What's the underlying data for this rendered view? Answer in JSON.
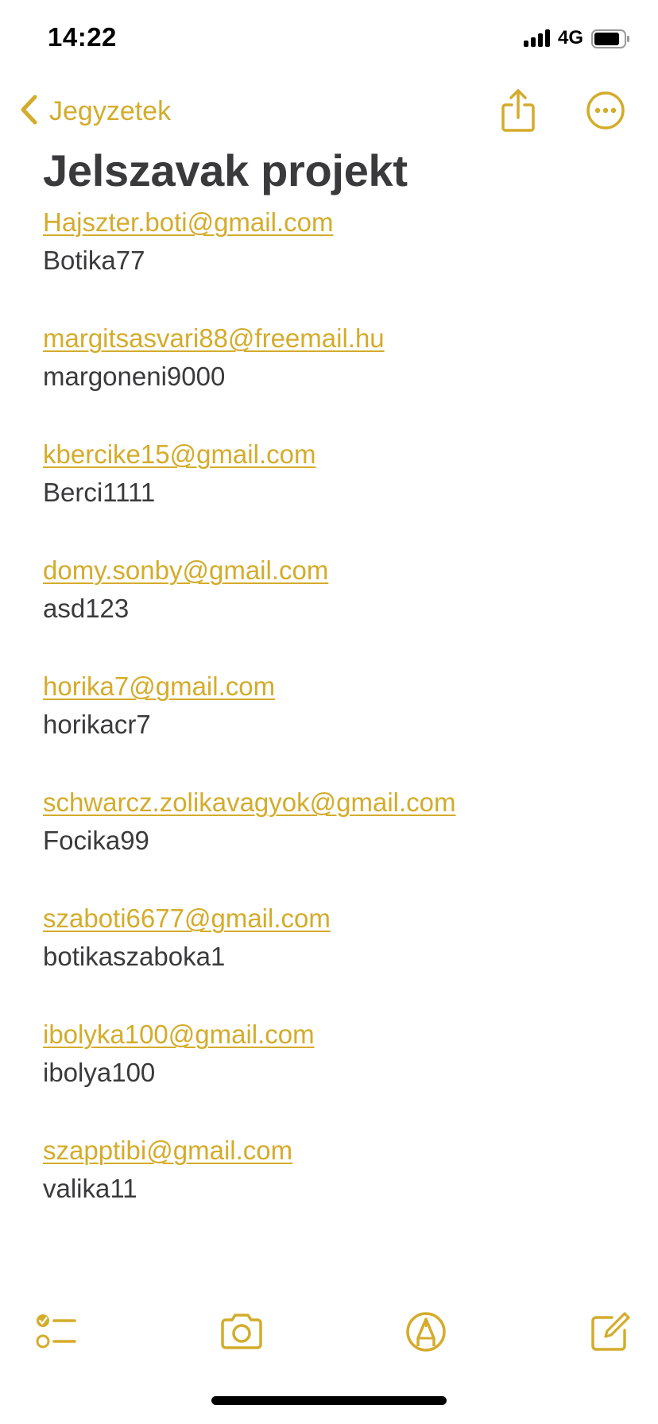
{
  "status_bar": {
    "time": "14:22",
    "network": "4G"
  },
  "nav": {
    "back_label": "Jegyzetek",
    "icons": {
      "back": "chevron-left-icon",
      "share": "share-icon",
      "more": "ellipsis-circle-icon"
    }
  },
  "note": {
    "title": "Jelszavak projekt",
    "entries": [
      {
        "email": "Hajszter.boti@gmail.com",
        "password": "Botika77"
      },
      {
        "email": "margitsasvari88@freemail.hu",
        "password": "margoneni9000"
      },
      {
        "email": "kbercike15@gmail.com",
        "password": "Berci1111"
      },
      {
        "email": "domy.sonby@gmail.com",
        "password": "asd123"
      },
      {
        "email": "horika7@gmail.com",
        "password": "horikacr7"
      },
      {
        "email": "schwarcz.zolikavagyok@gmail.com",
        "password": "Focika99"
      },
      {
        "email": "szaboti6677@gmail.com",
        "password": "botikaszaboka1"
      },
      {
        "email": "ibolyka100@gmail.com",
        "password": "ibolya100"
      },
      {
        "email": "szapptibi@gmail.com",
        "password": "valika11"
      }
    ]
  },
  "toolbar": {
    "icons": [
      "checklist-icon",
      "camera-icon",
      "markup-pen-icon",
      "compose-icon"
    ]
  },
  "colors": {
    "accent": "#d4ac2b",
    "text": "#3a3a3c",
    "background": "#ffffff"
  }
}
